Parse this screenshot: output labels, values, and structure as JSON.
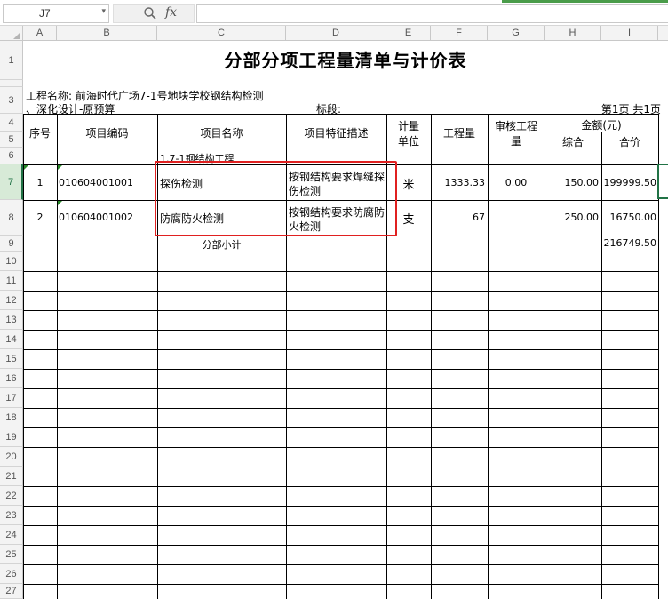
{
  "formula_bar": {
    "name_box": "J7",
    "fx_label": "fx",
    "formula": ""
  },
  "columns": [
    "A",
    "B",
    "C",
    "D",
    "E",
    "F",
    "G",
    "H",
    "I"
  ],
  "rows": [
    "1",
    "2",
    "3",
    "4",
    "5",
    "6",
    "7",
    "8",
    "9",
    "10",
    "11",
    "12",
    "13",
    "14",
    "15",
    "16",
    "17",
    "18",
    "19",
    "20",
    "21",
    "22",
    "23",
    "24",
    "25",
    "26",
    "27"
  ],
  "selected_row": "7",
  "sheet": {
    "title": "分部分项工程量清单与计价表",
    "project_line1": "工程名称: 前海时代广场7-1号地块学校钢结构检测",
    "project_line2": "、深化设计-原预算",
    "section_label": "标段:",
    "page_info": "第1页  共1页",
    "headers": {
      "seq": "序号",
      "code": "项目编码",
      "name": "项目名称",
      "desc": "项目特征描述",
      "unit_line1": "计量",
      "unit_line2": "单位",
      "qty": "工程量",
      "audit_line1": "审核工程",
      "audit_line2": "量",
      "amount": "金额(元)",
      "unit_price": "综合",
      "total": "合价"
    },
    "section_row": "1.7-1钢结构工程",
    "items": [
      {
        "seq": "1",
        "code": "010604001001",
        "name": "探伤检测",
        "desc_line1": "按钢结构要求焊缝探",
        "desc_line2": "伤检测",
        "unit": "米",
        "qty": "1333.33",
        "audit": "0.00",
        "unit_price": "150.00",
        "total": "199999.50"
      },
      {
        "seq": "2",
        "code": "010604001002",
        "name": "防腐防火检测",
        "desc_line1": "按钢结构要求防腐防",
        "desc_line2": "火检测",
        "unit": "支",
        "qty": "67",
        "audit": "",
        "unit_price": "250.00",
        "total": "16750.00"
      }
    ],
    "subtotal_label": "分部小计",
    "subtotal_value": "216749.50"
  }
}
